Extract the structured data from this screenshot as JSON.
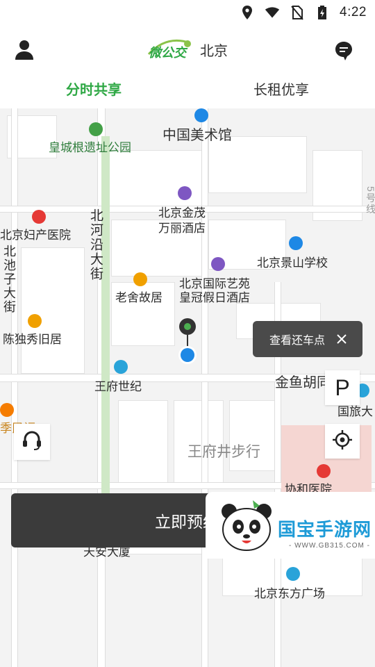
{
  "status_bar": {
    "time": "4:22",
    "icons": [
      "location-icon",
      "wifi-icon",
      "no-sim-icon",
      "battery-charging-icon"
    ]
  },
  "header": {
    "logo_text": "微公交",
    "city": "北京"
  },
  "tabs": [
    {
      "label": "分时共享",
      "active": true
    },
    {
      "label": "长租优享",
      "active": false
    }
  ],
  "map": {
    "pois": {
      "art_museum": "中国美术馆",
      "huangcheng_park": "皇城根遗址公园",
      "jinmao_hotel_1": "北京金茂",
      "jinmao_hotel_2": "万丽酒店",
      "maternity_hospital": "北京妇产医院",
      "beiheyan_street": "北河沿大街",
      "jingshan_school": "北京景山学校",
      "laoshe_house": "老舍故居",
      "intl_art_hotel_1": "北京国际艺苑",
      "intl_art_hotel_2": "皇冠假日酒店",
      "beichizi_street": "北池子大街",
      "chen_duxiu_house": "陈独秀旧居",
      "wangfu_century": "王府世纪",
      "jinyu_hutong": "金鱼胡同",
      "cits": "国旅大",
      "jiminfu": "季民福",
      "wangfujing": "王府井步行",
      "xiehe_hospital": "协和医院",
      "tianan_building": "天安大厦",
      "oriental_plaza": "北京东方广场",
      "edge_label": "5号线"
    }
  },
  "controls": {
    "tooltip_label": "查看还车点",
    "parking_label": "P",
    "book_label": "立即预约"
  },
  "watermark": {
    "title": "国宝手游网",
    "url": "- WWW.GB315.COM -"
  },
  "colors": {
    "accent": "#2fa845",
    "button_dark": "#3b3b3b",
    "tooltip_bg": "#4a4a4a",
    "location_blue": "#1e88e5"
  }
}
